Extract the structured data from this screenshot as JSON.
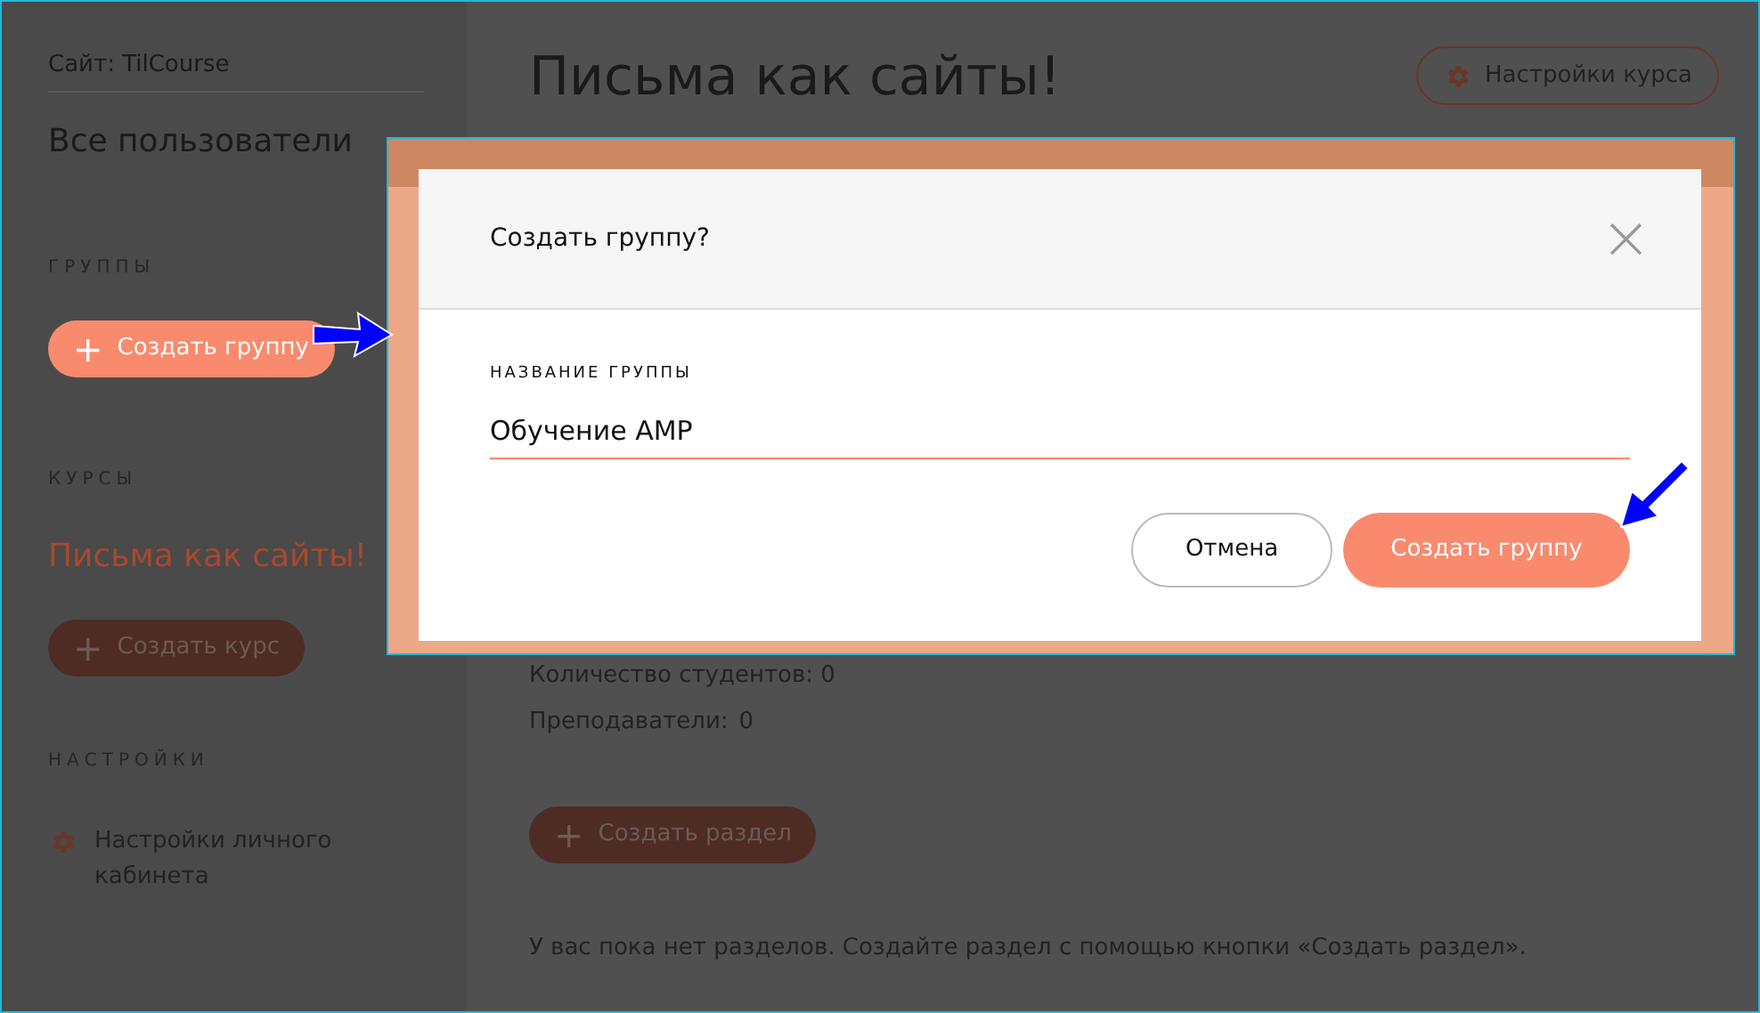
{
  "sidebar": {
    "site": "Сайт: TilCourse",
    "all_users": "Все пользователи",
    "sections": [
      {
        "kind": "groups",
        "heading": "ГРУППЫ",
        "button": {
          "icon": "+",
          "label": "Создать группу",
          "highlighted": true
        }
      },
      {
        "kind": "courses",
        "heading": "КУРСЫ",
        "course": "Письма как сайты!",
        "button": {
          "icon": "+",
          "label": "Создать курс",
          "highlighted": false
        }
      },
      {
        "kind": "settings",
        "heading": "НАСТРОЙКИ",
        "link": "Настройки личного кабинета"
      }
    ]
  },
  "main": {
    "title": "Письма как сайты!",
    "settings_button": "Настройки курса",
    "students": "Количество студентов: 0",
    "teachers_label": "Преподаватели:",
    "teachers_value": "0",
    "create_section": {
      "icon": "+",
      "label": "Создать раздел"
    },
    "empty_note": "У вас пока нет разделов. Создайте раздел с помощью кнопки «Создать раздел»."
  },
  "dialog": {
    "title": "Создать группу?",
    "close": "×",
    "field_label": "НАЗВАНИЕ ГРУППЫ",
    "field_value": "Обучение AMP",
    "buttons": [
      {
        "kind": "secondary",
        "label": "Отмена"
      },
      {
        "kind": "primary",
        "label": "Создать группу"
      }
    ]
  }
}
